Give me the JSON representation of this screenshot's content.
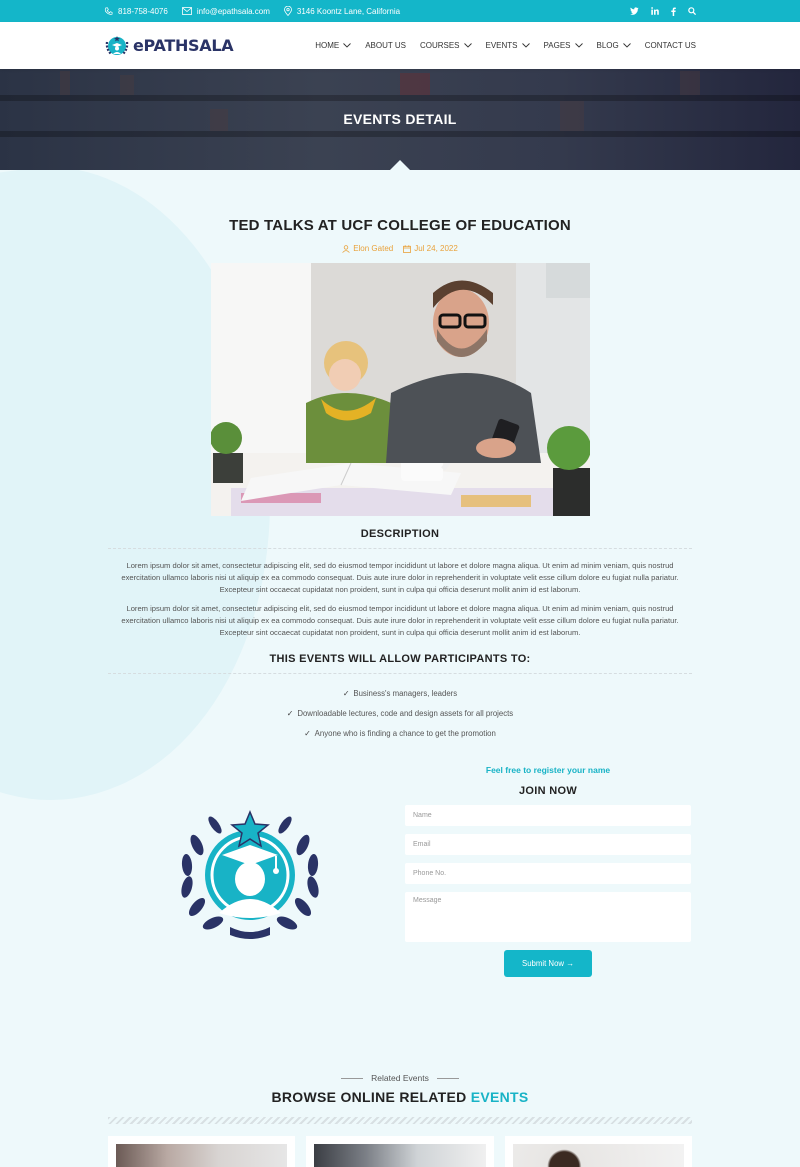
{
  "topbar": {
    "phone": "818-758-4076",
    "email": "info@epathsala.com",
    "address": "3146 Koontz Lane, California",
    "socials": [
      "twitter-icon",
      "linkedin-icon",
      "facebook-icon",
      "search-icon"
    ]
  },
  "brand": {
    "name": "ePATHSALA"
  },
  "nav": {
    "items": [
      {
        "label": "HOME"
      },
      {
        "label": "ABOUT US"
      },
      {
        "label": "COURSES"
      },
      {
        "label": "EVENTS"
      },
      {
        "label": "PAGES"
      },
      {
        "label": "BLOG"
      },
      {
        "label": "CONTACT US"
      }
    ]
  },
  "hero": {
    "title": "EVENTS DETAIL"
  },
  "event": {
    "title": "TED TALKS AT UCF COLLEGE OF EDUCATION",
    "author": "Elon Gated",
    "date": "Jul 24, 2022"
  },
  "description": {
    "heading": "DESCRIPTION",
    "p1": "Lorem ipsum dolor sit amet, consectetur adipiscing elit, sed do eiusmod tempor incididunt ut labore et dolore magna aliqua. Ut enim ad minim veniam, quis nostrud exercitation ullamco laboris nisi ut aliquip ex ea commodo consequat. Duis aute irure dolor in reprehenderit in voluptate velit esse cillum dolore eu fugiat nulla pariatur. Excepteur sint occaecat cupidatat non proident, sunt in culpa qui officia deserunt mollit anim id est laborum.",
    "p2": "Lorem ipsum dolor sit amet, consectetur adipiscing elit, sed do eiusmod tempor incididunt ut labore et dolore magna aliqua. Ut enim ad minim veniam, quis nostrud exercitation ullamco laboris nisi ut aliquip ex ea commodo consequat. Duis aute irure dolor in reprehenderit in voluptate velit esse cillum dolore eu fugiat nulla pariatur. Excepteur sint occaecat cupidatat non proident, sunt in culpa qui officia deserunt mollit anim id est laborum."
  },
  "participants": {
    "heading": "THIS EVENTS WILL ALLOW PARTICIPANTS TO:",
    "items": [
      "Business's managers, leaders",
      "Downloadable lectures, code and design assets for all projects",
      "Anyone who is finding a chance to get the promotion"
    ]
  },
  "join": {
    "tagline": "Feel free to register your name",
    "heading": "JOIN NOW",
    "name_placeholder": "Name",
    "email_placeholder": "Email",
    "phone_placeholder": "Phone No.",
    "message_placeholder": "Message",
    "submit_label": "Submit Now →"
  },
  "related": {
    "subtitle": "Related Events",
    "title_main": "BROWSE ONLINE RELATED ",
    "title_accent": "EVENTS"
  },
  "colors": {
    "accent": "#14b6c9",
    "brand_navy": "#2a3366",
    "meta_orange": "#e9a23b"
  }
}
